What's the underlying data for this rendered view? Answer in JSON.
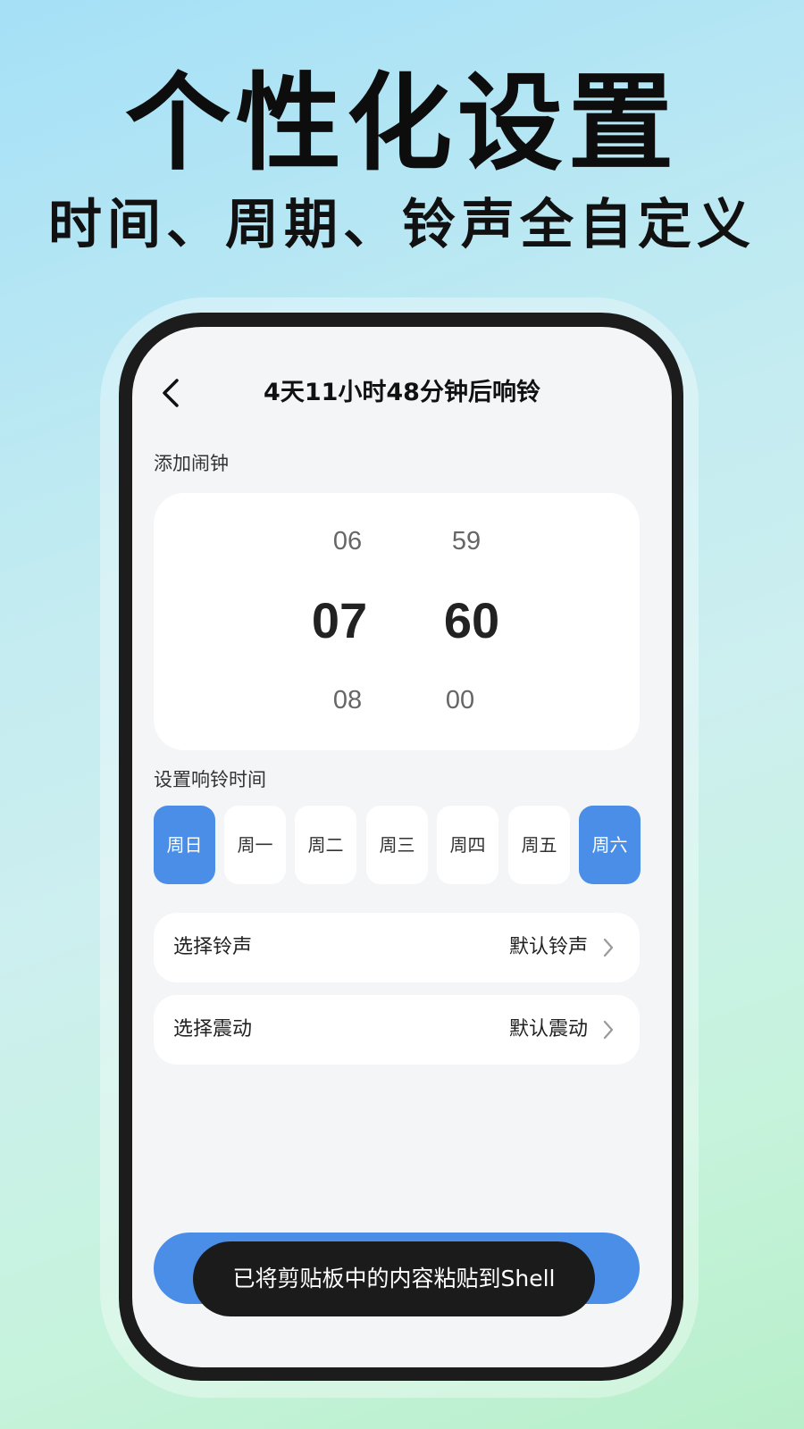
{
  "promo": {
    "headline": "个性化设置",
    "subheadline": "时间、周期、铃声全自定义"
  },
  "app_bar": {
    "back_icon": "chevron-left-icon",
    "title": "4天11小时48分钟后响铃"
  },
  "add_alarm": {
    "label": "添加闹钟",
    "hour_prev": "06",
    "hour_selected": "07",
    "hour_next": "08",
    "minute_prev": "59",
    "minute_selected": "60",
    "minute_next": "00"
  },
  "repeat": {
    "label": "设置响铃时间",
    "days": [
      {
        "label": "周日",
        "selected": true
      },
      {
        "label": "周一",
        "selected": false
      },
      {
        "label": "周二",
        "selected": false
      },
      {
        "label": "周三",
        "selected": false
      },
      {
        "label": "周四",
        "selected": false
      },
      {
        "label": "周五",
        "selected": false
      },
      {
        "label": "周六",
        "selected": true
      }
    ]
  },
  "settings": {
    "ringtone_label": "选择铃声",
    "ringtone_value": "默认铃声",
    "vibration_label": "选择震动",
    "vibration_value": "默认震动"
  },
  "toast": {
    "text": "已将剪贴板中的内容粘贴到Shell"
  },
  "colors": {
    "accent": "#4a8ee8",
    "frame": "#1c1c1c",
    "screen_bg": "#f4f5f7"
  }
}
